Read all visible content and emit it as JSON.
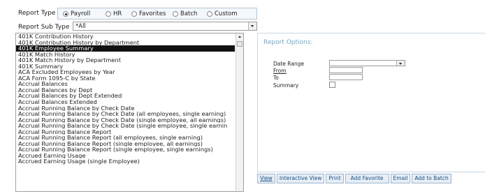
{
  "report_type": {
    "label": "Report Type",
    "options": [
      "Payroll",
      "HR",
      "Favorites",
      "Batch",
      "Custom"
    ],
    "selected": "Payroll"
  },
  "report_sub_type": {
    "label": "Report Sub Type",
    "value": "*All"
  },
  "report_list": {
    "selected_index": 2,
    "items": [
      "401K Contribution History",
      "401K Contribution History by Department",
      "401K Employee Summary",
      "401K Match History",
      "401K Match History by Department",
      "401K Summary",
      "ACA Excluded Employees by Year",
      "ACA Form 1095-C by State",
      "Accrual Balances",
      "Accrual Balances by Dept",
      "Accrual Balances by Dept Extended",
      "Accrual Balances Extended",
      "Accrual Running Balance by Check Date",
      "Accrual Running Balance by Check Date (all employees, single earning)",
      "Accrual Running Balance by Check Date (single employee, all earnings)",
      "Accrual Running Balance by Check Date (single employee, single earnin",
      "Accrual Running Balance Report",
      "Accrual Running Balance Report (all employees, single earning)",
      "Accrual Running Balance Report (single employee, all earnings)",
      "Accrual Running Balance Report (single employee, single earnings)",
      "Accrued Earning Usage",
      "Accrued Earning Usage (single Employee)"
    ]
  },
  "report_options": {
    "title": "Report Options:",
    "date_range_label": "Date Range",
    "date_range_value": "",
    "from_label": "From",
    "from_value": "",
    "to_label": "To",
    "to_value": "",
    "summary_label": "Summary",
    "summary_checked": false
  },
  "actions": {
    "view": "View",
    "interactive_view": "Interactive View",
    "print": "Print",
    "add_favorite": "Add Favorite",
    "email": "Email",
    "add_to_batch": "Add to Batch"
  }
}
